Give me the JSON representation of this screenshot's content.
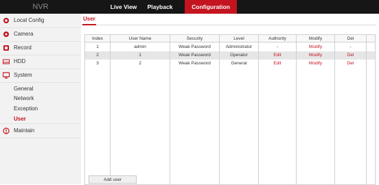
{
  "app": {
    "logo": "NVR"
  },
  "topnav": {
    "items": [
      "Live View",
      "Playback",
      "Configuration"
    ],
    "active": "Configuration"
  },
  "sidebar": {
    "items": [
      {
        "label": "Local Config",
        "icon": "local-config-icon"
      },
      {
        "label": "Camera",
        "icon": "camera-icon"
      },
      {
        "label": "Record",
        "icon": "record-icon"
      },
      {
        "label": "HDD",
        "icon": "hdd-icon"
      },
      {
        "label": "System",
        "icon": "monitor-icon"
      }
    ],
    "sub_items": [
      "General",
      "Network",
      "Exception",
      "User"
    ],
    "active_sub": "User",
    "maintain": {
      "label": "Maintain",
      "icon": "info-icon"
    }
  },
  "main": {
    "tab": "User",
    "table": {
      "headers": [
        "Index",
        "User Name",
        "Security",
        "Level",
        "Authority",
        "Modify",
        "Del"
      ],
      "rows": [
        [
          "1",
          "admin",
          "Weak Password",
          "Administrator",
          "-",
          "Modify",
          "-"
        ],
        [
          "2",
          "1",
          "Weak Password",
          "Operator",
          "Edit",
          "Modify",
          "Del"
        ],
        [
          "3",
          "2",
          "Weak Password",
          "General",
          "Edit",
          "Modify",
          "Del"
        ]
      ]
    },
    "add_user_button": "Add user"
  },
  "colors": {
    "accent": "#c3141f",
    "topbar": "#161616",
    "sidebar": "#f2f2f2",
    "row_alt": "#e6e6e6"
  }
}
